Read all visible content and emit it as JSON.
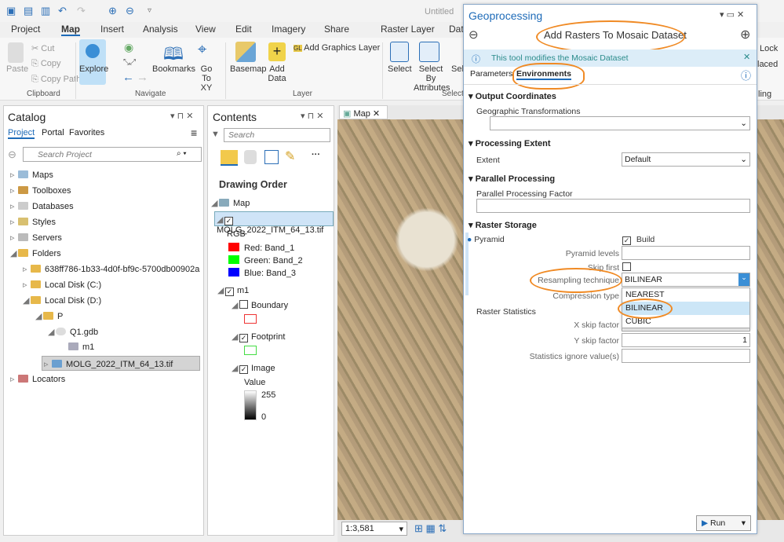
{
  "window_title": "Untitled",
  "ribbon_tabs": [
    "Project",
    "Map",
    "Insert",
    "Analysis",
    "View",
    "Edit",
    "Imagery",
    "Share",
    "Raster Layer",
    "Dat"
  ],
  "active_tab": "Map",
  "ribbon": {
    "clipboard": {
      "paste": "Paste",
      "cut": "Cut",
      "copy": "Copy",
      "copy_path": "Copy Path",
      "group": "Clipboard"
    },
    "navigate": {
      "explore": "Explore",
      "bookmarks": "Bookmarks",
      "go_to_xy": "Go To XY",
      "group": "Navigate"
    },
    "layer": {
      "basemap": "Basemap",
      "add_data": "Add Data",
      "add_graphics": "Add Graphics Layer",
      "group": "Layer"
    },
    "selection": {
      "select": "Select",
      "select_by_attr": "Select By Attributes",
      "select_loc": "Sel Loc",
      "group": "Selecti"
    },
    "right_partial": [
      "Lock",
      "laced",
      "ling"
    ]
  },
  "catalog": {
    "title": "Catalog",
    "tabs": [
      "Project",
      "Portal",
      "Favorites"
    ],
    "search_placeholder": "Search Project",
    "items": [
      "Maps",
      "Toolboxes",
      "Databases",
      "Styles",
      "Servers",
      "Folders",
      "638ff786-1b33-4d0f-bf9c-5700db00902a",
      "Local Disk (C:)",
      "Local Disk (D:)",
      "P",
      "Q1.gdb",
      "m1",
      "MOLG_2022_ITM_64_13.tif",
      "Locators"
    ]
  },
  "contents": {
    "title": "Contents",
    "search_placeholder": "Search",
    "drawing_order": "Drawing Order",
    "map": "Map",
    "layer": "MOLG_2022_ITM_64_13.tif",
    "rgb": "RGB",
    "bands": [
      {
        "label": "Red: Band_1",
        "color": "#ff0000"
      },
      {
        "label": "Green: Band_2",
        "color": "#00ff00"
      },
      {
        "label": "Blue: Band_3",
        "color": "#0000ff"
      }
    ],
    "mosaic": "m1",
    "boundary": "Boundary",
    "footprint": "Footprint",
    "image": "Image",
    "value": "Value",
    "value_max": "255",
    "value_min": "0"
  },
  "map_view": {
    "tab": "Map",
    "scale": "1:3,581"
  },
  "geoprocessing": {
    "title": "Geoprocessing",
    "tool": "Add Rasters To Mosaic Dataset",
    "info": "This tool modifies the Mosaic Dataset",
    "tabs": [
      "Parameters",
      "Environments"
    ],
    "sections": {
      "output_coords": "Output Coordinates",
      "geo_transform": "Geographic Transformations",
      "processing_extent": "Processing Extent",
      "extent": "Extent",
      "extent_value": "Default",
      "parallel": "Parallel Processing",
      "parallel_factor": "Parallel Processing Factor",
      "raster_storage": "Raster Storage",
      "pyramid": "Pyramid",
      "build": "Build",
      "pyramid_levels": "Pyramid levels",
      "skip_first": "Skip first",
      "resampling": "Resampling technique",
      "resampling_value": "BILINEAR",
      "compression": "Compression type",
      "raster_stats": "Raster Statistics",
      "x_skip": "X skip factor",
      "y_skip": "Y skip factor",
      "y_skip_value": "1",
      "stats_ignore": "Statistics ignore value(s)"
    },
    "dropdown_options": [
      "NEAREST",
      "BILINEAR",
      "CUBIC"
    ],
    "selected_option": "BILINEAR",
    "run": "Run"
  }
}
